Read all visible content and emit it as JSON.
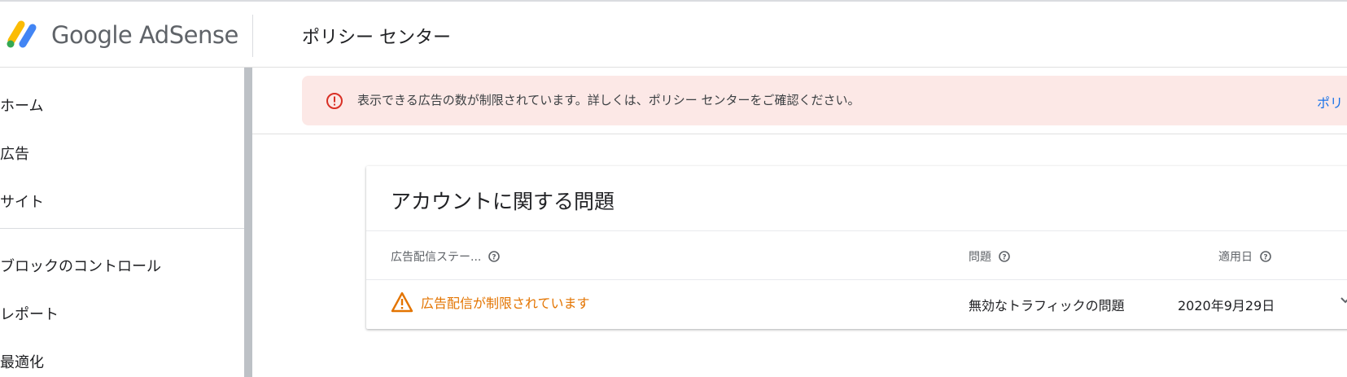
{
  "header": {
    "brand": "Google AdSense",
    "page_title": "ポリシー センター"
  },
  "sidebar": {
    "items": [
      {
        "label": "ホーム"
      },
      {
        "label": "広告"
      },
      {
        "label": "サイト"
      },
      {
        "label": "ブロックのコントロール"
      },
      {
        "label": "レポート"
      },
      {
        "label": "最適化"
      }
    ]
  },
  "banner": {
    "icon": "error-icon",
    "text": "表示できる広告の数が制限されています。詳しくは、ポリシー センターをご確認ください。",
    "link": "ポリ"
  },
  "card": {
    "title": "アカウントに関する問題",
    "columns": [
      "広告配信ステー...",
      "問題",
      "適用日"
    ],
    "rows": [
      {
        "status": "広告配信が制限されています",
        "issue": "無効なトラフィックの問題",
        "date": "2020年9月29日"
      }
    ]
  },
  "colors": {
    "banner_bg": "#fce8e6",
    "error_red": "#d93025",
    "warning_orange": "#e37400",
    "link_blue": "#1a73e8"
  }
}
